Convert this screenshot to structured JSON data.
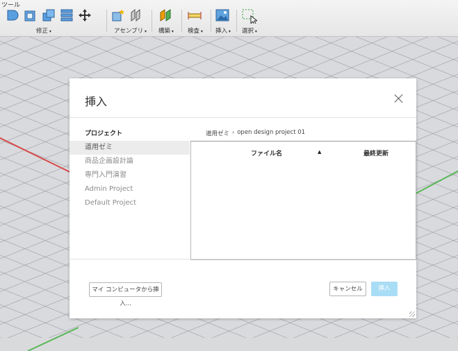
{
  "toolbar": {
    "title": "ツール",
    "groups": [
      {
        "label": "修正"
      },
      {
        "label": "アセンブリ"
      },
      {
        "label": "構築"
      },
      {
        "label": "検査"
      },
      {
        "label": "挿入"
      },
      {
        "label": "選択"
      }
    ]
  },
  "dialog": {
    "title": "挿入",
    "projects_header": "プロジェクト",
    "projects": [
      "道用ゼミ",
      "商品企画設計論",
      "専門入門演習",
      "Admin Project",
      "Default Project"
    ],
    "selected_project_index": 0,
    "breadcrumb": {
      "root": "道用ゼミ",
      "separator": "›",
      "current": "open design project 01"
    },
    "file_table": {
      "columns": [
        "ファイル名",
        "最終更新"
      ],
      "sort_indicator": "▲",
      "rows": []
    },
    "buttons": {
      "upload": "マイ コンピュータから挿入...",
      "cancel": "キャンセル",
      "insert": "挿入"
    }
  },
  "colors": {
    "insert_button": "#a9ddf5",
    "selected_row": "#ececec",
    "axis_x": "#d84a4a",
    "axis_y": "#58b858"
  }
}
